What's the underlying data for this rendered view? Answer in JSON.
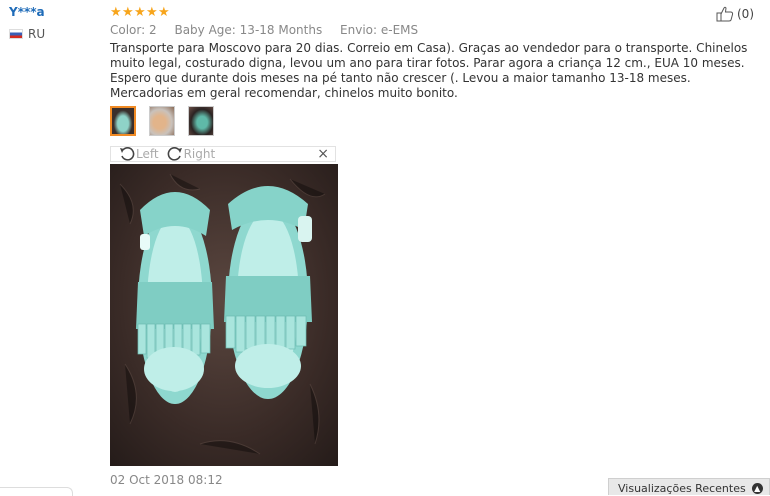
{
  "user": {
    "name": "Y***a",
    "country": "RU",
    "flag_icon": "russia-flag-icon"
  },
  "review": {
    "rating": 5,
    "stars": [
      "★",
      "★",
      "★",
      "★",
      "★"
    ],
    "color_label": "Color:",
    "color_value": "2",
    "baby_age_label": "Baby Age:",
    "baby_age_value": "13-18 Months",
    "shipping_label": "Envio:",
    "shipping_value": "e-EMS",
    "text": "Transporte para Moscovo para 20 dias. Correio em Casa). Graças ao vendedor para o transporte. Chinelos muito legal, costurado digna, levou um ano para tirar fotos. Parar agora a criança 12 cm., EUA 10 meses. Espero que durante dois meses na pé tanto não crescer (. Levou a maior tamanho 13-18 meses. Mercadorias em geral recomendar, chinelos muito bonito.",
    "likes": "(0)",
    "date": "02 Oct 2018 08:12"
  },
  "viewer": {
    "rotate_left": "Left",
    "rotate_right": "Right",
    "close": "×"
  },
  "recent_panel": {
    "label": "Visualizações Recentes"
  },
  "colors": {
    "star": "#f7a51c",
    "user_link": "#1e6bb8",
    "selected_thumb": "#f08a24",
    "shoe": "#8ed8cf"
  }
}
